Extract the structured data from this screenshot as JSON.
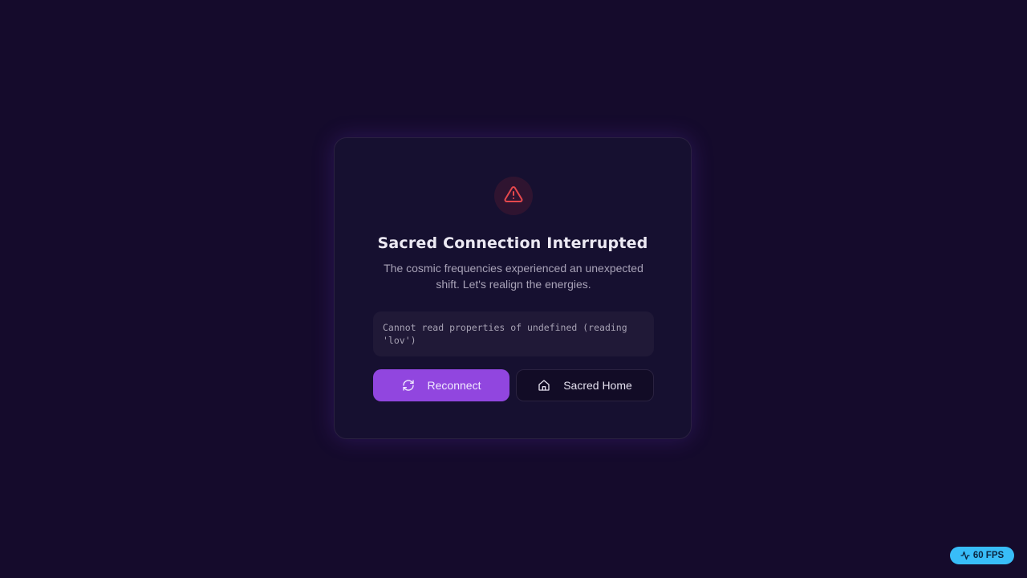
{
  "error_card": {
    "icon": "alert-triangle-icon",
    "title": "Sacred Connection Interrupted",
    "message": "The cosmic frequencies experienced an unexpected shift. Let's realign the energies.",
    "error_detail": "Cannot read properties of undefined (reading 'lov')",
    "actions": {
      "reconnect": {
        "label": "Reconnect",
        "icon": "refresh-icon"
      },
      "home": {
        "label": "Sacred Home",
        "icon": "home-icon"
      }
    }
  },
  "fps_badge": {
    "icon": "activity-icon",
    "label": "60 FPS"
  },
  "colors": {
    "background": "#150b2c",
    "card": "#161030",
    "accent": "#9146df",
    "danger": "#e5484d",
    "badge": "#38bdf8"
  }
}
